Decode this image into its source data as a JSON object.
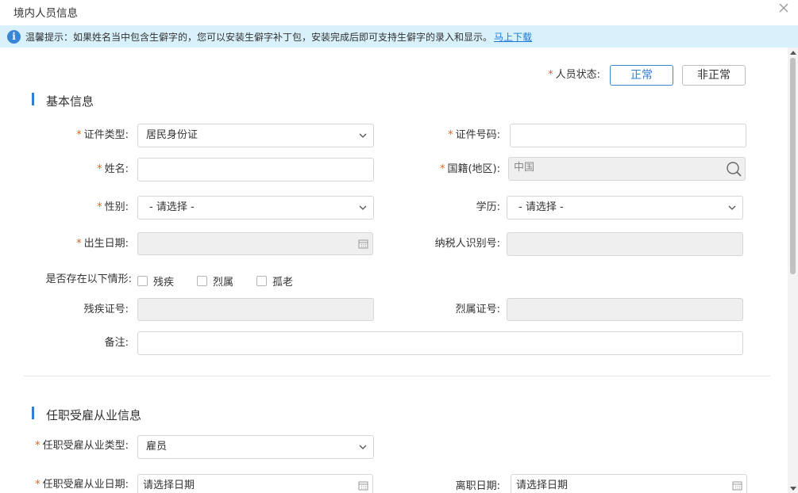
{
  "dialog": {
    "title": "境内人员信息",
    "notice_text": "温馨提示：如果姓名当中包含生僻字的，您可以安装生僻字补丁包，安装完成后即可支持生僻字的录入和显示。",
    "notice_link": "马上下载"
  },
  "status": {
    "label": "人员状态:",
    "normal": "正常",
    "abnormal": "非正常"
  },
  "basic": {
    "section_title": "基本信息",
    "id_type_label": "证件类型:",
    "id_type_value": "居民身份证",
    "id_number_label": "证件号码:",
    "name_label": "姓名:",
    "nationality_label": "国籍(地区):",
    "nationality_value": "中国",
    "gender_label": "性别:",
    "gender_value": "- 请选择 -",
    "education_label": "学历:",
    "education_value": "- 请选择 -",
    "birth_label": "出生日期:",
    "taxpayer_label": "纳税人识别号:",
    "situation_label": "是否存在以下情形:",
    "situations": [
      "残疾",
      "烈属",
      "孤老"
    ],
    "disability_cert_label": "残疾证号:",
    "martyr_cert_label": "烈属证号:",
    "remarks_label": "备注:"
  },
  "employment": {
    "section_title": "任职受雇从业信息",
    "type_label": "任职受雇从业类型:",
    "type_value": "雇员",
    "date_label": "任职受雇从业日期:",
    "date_placeholder": "请选择日期",
    "leave_label": "离职日期:",
    "leave_placeholder": "请选择日期"
  }
}
